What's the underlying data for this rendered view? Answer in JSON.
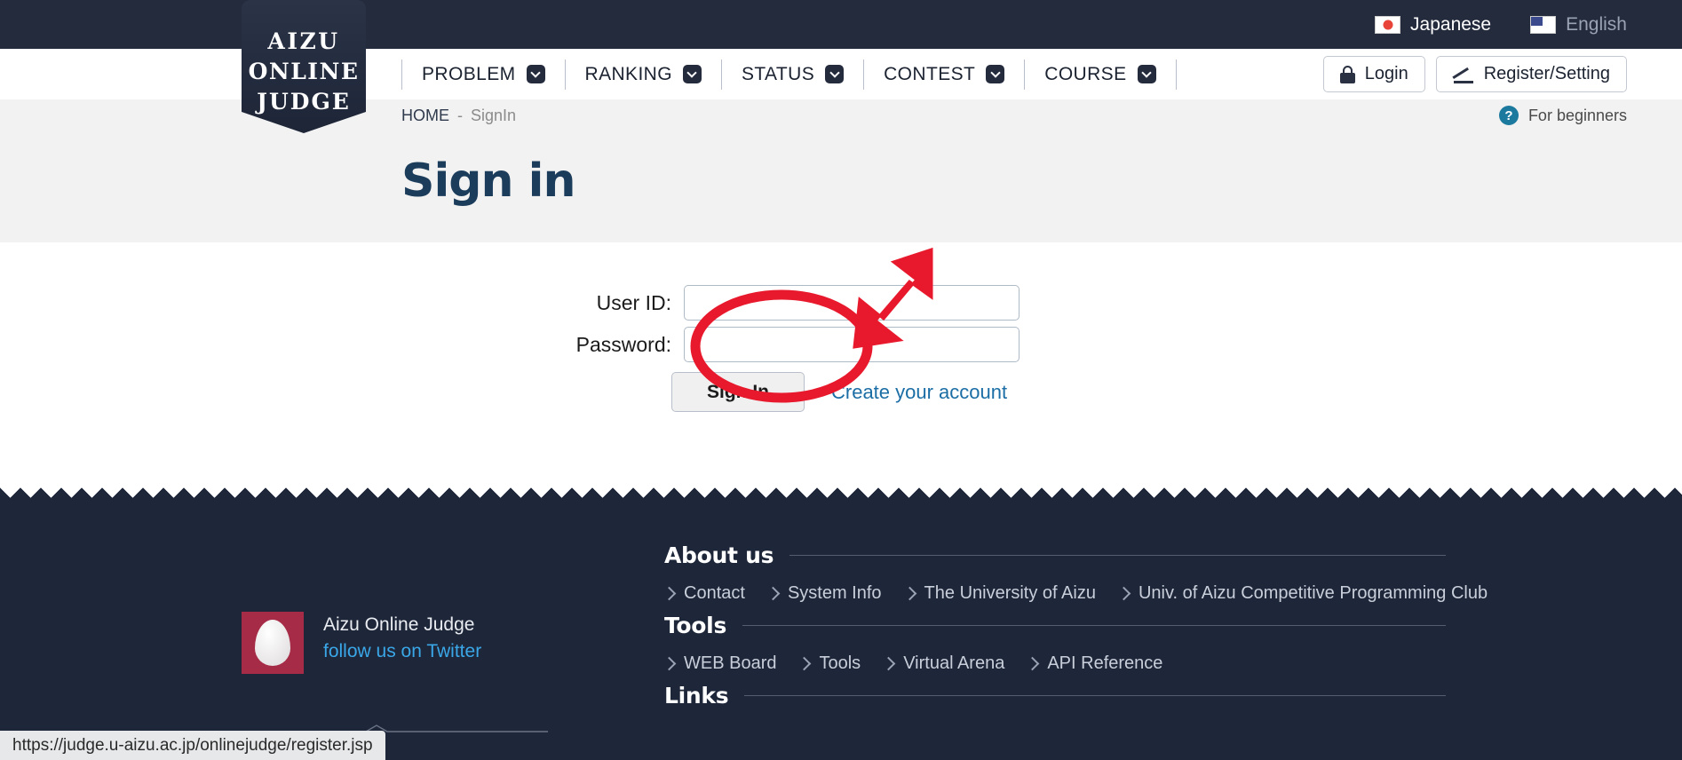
{
  "topbar": {
    "languages": [
      {
        "label": "Japanese",
        "icon": "flag-japan-icon",
        "state": "active"
      },
      {
        "label": "English",
        "icon": "flag-usa-icon",
        "state": "inactive"
      }
    ]
  },
  "logo": {
    "line1": "AIZU",
    "line2": "ONLINE",
    "line3": "JUDGE"
  },
  "nav": {
    "items": [
      {
        "label": "PROBLEM"
      },
      {
        "label": "RANKING"
      },
      {
        "label": "STATUS"
      },
      {
        "label": "CONTEST"
      },
      {
        "label": "COURSE"
      }
    ],
    "login_label": "Login",
    "register_label": "Register/Setting"
  },
  "breadcrumb": {
    "home": "HOME",
    "separator": "-",
    "current": "SignIn",
    "beginners_label": "For beginners",
    "beginners_badge": "?"
  },
  "page": {
    "title": "Sign in"
  },
  "form": {
    "userid_label": "User ID:",
    "userid_value": "",
    "userid_placeholder": "",
    "password_label": "Password:",
    "password_value": "",
    "password_placeholder": "",
    "signin_label": "Sign In",
    "create_account_label": "Create your account"
  },
  "annotation": {
    "color": "#e8192c",
    "shapes": [
      "ellipse-highlight",
      "arrow-pointer"
    ],
    "target": "Create your account"
  },
  "footer": {
    "twitter": {
      "name": "Aizu Online Judge",
      "link": "follow us on Twitter"
    },
    "sections": [
      {
        "heading": "About us",
        "links": [
          "Contact",
          "System Info",
          "The University of Aizu",
          "Univ. of Aizu Competitive Programming Club"
        ]
      },
      {
        "heading": "Tools",
        "links": [
          "WEB Board",
          "Tools",
          "Virtual Arena",
          "API Reference"
        ]
      },
      {
        "heading": "Links",
        "links": []
      }
    ]
  },
  "statusbar": {
    "url": "https://judge.u-aizu.ac.jp/onlinejudge/register.jsp"
  },
  "colors": {
    "header_dark": "#232b3d",
    "footer_dark": "#1e2639",
    "title_navy": "#1b3c5a",
    "link_blue": "#1b6ea5",
    "annotation_red": "#e8192c",
    "avatar_crimson": "#a62b47"
  }
}
